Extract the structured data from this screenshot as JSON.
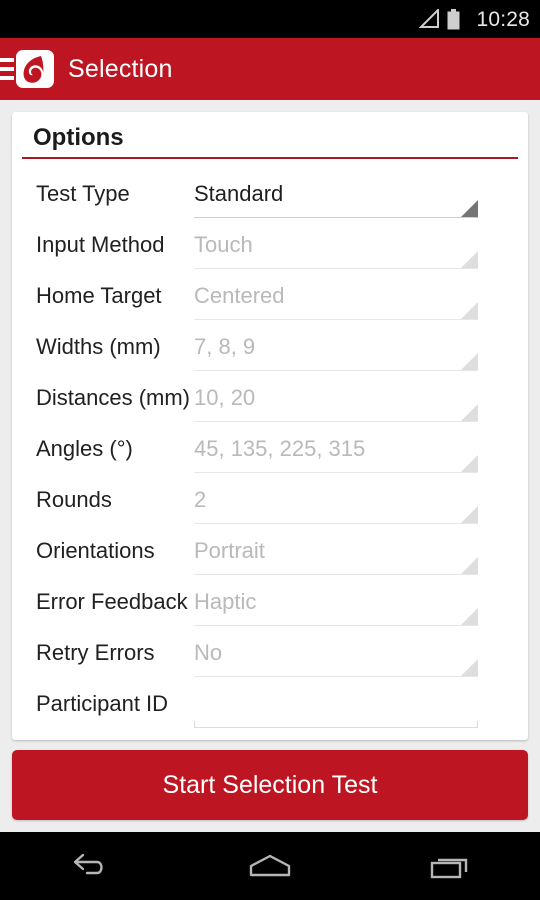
{
  "status_bar": {
    "clock": "10:28",
    "signal_icon": "signal-triangle-icon",
    "battery_icon": "battery-icon"
  },
  "app_bar": {
    "menu_icon": "hamburger-menu-icon",
    "logo_icon": "app-logo-icon",
    "title": "Selection",
    "color": "#bd1622"
  },
  "options_card": {
    "title": "Options",
    "accent_color": "#a81a20",
    "rows": [
      {
        "label": "Test Type",
        "value": "Standard",
        "control": "spinner",
        "enabled": true
      },
      {
        "label": "Input Method",
        "value": "Touch",
        "control": "spinner",
        "enabled": false
      },
      {
        "label": "Home Target",
        "value": "Centered",
        "control": "spinner",
        "enabled": false
      },
      {
        "label": "Widths (mm)",
        "value": "7, 8, 9",
        "control": "spinner",
        "enabled": false
      },
      {
        "label": "Distances (mm)",
        "value": "10, 20",
        "control": "spinner",
        "enabled": false
      },
      {
        "label": "Angles (°)",
        "value": "45, 135, 225, 315",
        "control": "spinner",
        "enabled": false
      },
      {
        "label": "Rounds",
        "value": "2",
        "control": "spinner",
        "enabled": false
      },
      {
        "label": "Orientations",
        "value": "Portrait",
        "control": "spinner",
        "enabled": false
      },
      {
        "label": "Error Feedback",
        "value": "Haptic",
        "control": "spinner",
        "enabled": false
      },
      {
        "label": "Retry Errors",
        "value": "No",
        "control": "spinner",
        "enabled": false
      },
      {
        "label": "Participant ID",
        "value": "",
        "control": "textfield",
        "placeholder": "",
        "enabled": true
      }
    ]
  },
  "start_button": {
    "label": "Start Selection Test",
    "color": "#bd1622"
  },
  "nav_bar": {
    "back_icon": "back-arrow-icon",
    "home_icon": "home-icon",
    "recents_icon": "recent-apps-icon"
  }
}
